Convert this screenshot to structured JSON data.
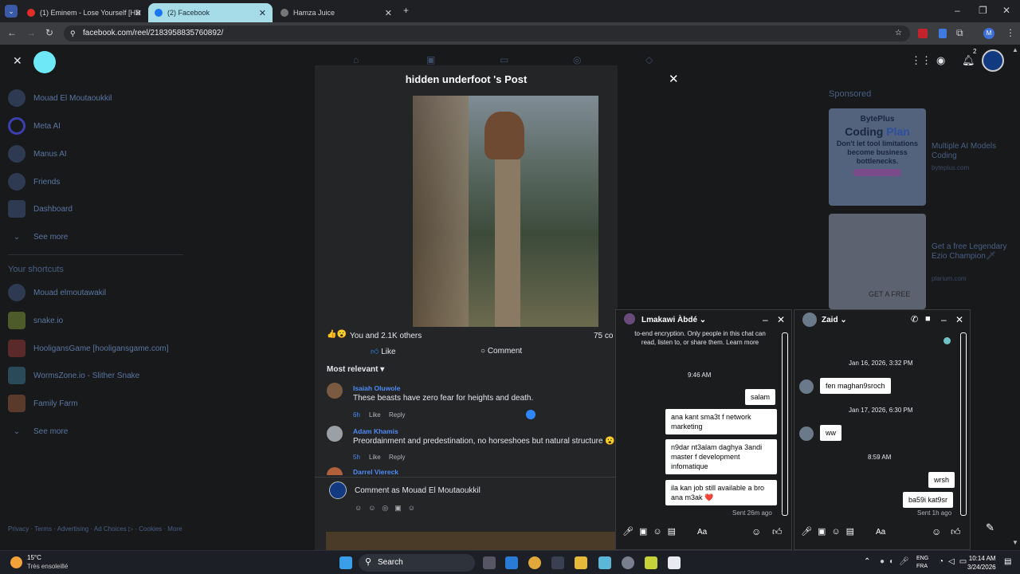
{
  "browser": {
    "tabs": [
      {
        "label": "(1) Eminem - Lose Yourself [HD",
        "active": false
      },
      {
        "label": "(2) Facebook",
        "active": true
      },
      {
        "label": "Hamza Juice",
        "active": false
      }
    ],
    "url": "facebook.com/reel/2183958835760892/"
  },
  "sidebar": {
    "items": [
      {
        "label": "Mouad El Moutaoukkil"
      },
      {
        "label": "Meta AI"
      },
      {
        "label": "Manus AI"
      },
      {
        "label": "Friends"
      },
      {
        "label": "Dashboard"
      },
      {
        "label": "See more"
      }
    ],
    "shortcuts_title": "Your shortcuts",
    "shortcuts": [
      {
        "label": "Mouad elmoutawakil"
      },
      {
        "label": "snake.io"
      },
      {
        "label": "HooligansGame [hooligansgame.com]"
      },
      {
        "label": "WormsZone.io - Slither Snake"
      },
      {
        "label": "Family Farm"
      },
      {
        "label": "See more"
      }
    ],
    "footer": "Privacy · Terms · Advertising · Ad Choices ▷ · Cookies · More"
  },
  "header": {
    "notification_count": "2"
  },
  "sponsored": {
    "title": "Sponsored",
    "ads": [
      {
        "brand": "BytePlus",
        "banner_line1": "Coding ",
        "banner_line1_accent": "Plan",
        "banner_text": "Don't let tool limitations become business bottlenecks.",
        "title": "Multiple AI Models Coding",
        "domain": "byteplus.com"
      },
      {
        "title": "Get a free Legendary Ezio Champion🗡",
        "domain": "plarium.com",
        "banner_text": "GET A FREE"
      }
    ]
  },
  "modal": {
    "title": "hidden underfoot 's Post",
    "reactions": "You and 2.1K others",
    "comment_count": "75 co",
    "like_label": "Like",
    "comment_label": "Comment",
    "sort_label": "Most relevant",
    "comments": [
      {
        "name": "Isaiah Oluwole",
        "text": "These beasts have zero fear for heights and death.",
        "time": "6h",
        "like": "Like",
        "reply": "Reply"
      },
      {
        "name": "Adam Khamis",
        "text": "Preordainment and predestination, no horseshoes but natural structure 😮",
        "time": "5h",
        "like": "Like",
        "reply": "Reply"
      },
      {
        "name": "Darrel Viereck"
      }
    ],
    "comment_placeholder": "Comment as Mouad El Moutaoukkil"
  },
  "chat1": {
    "name": "Lmakawi Àbdé",
    "encryption": "to-end encryption. Only people in this chat can read, listen to, or share them. Learn more",
    "time": "9:46 AM",
    "messages": [
      "salam",
      "ana kant sma3t f network marketing",
      "n9dar nt3alam daghya 3andi master f development infomatique",
      "ila kan job still available a bro ana m3ak ❤️"
    ],
    "status": "Sent 26m ago",
    "input": "Aa"
  },
  "chat2": {
    "name": "Zaid",
    "date1": "Jan 16, 2026, 3:32 PM",
    "msg1": "fen maghan9sroch",
    "date2": "Jan 17, 2026, 6:30 PM",
    "msg2": "ww",
    "time3": "8:59 AM",
    "msg3": "wrsh",
    "msg4": "ba59i kat9sr",
    "status": "Sent 1h ago",
    "input": "Aa"
  },
  "taskbar": {
    "temp": "15°C",
    "weather": "Très ensoleillé",
    "search": "Search",
    "lang1": "ENG",
    "lang2": "FRA",
    "time": "10:14 AM",
    "date": "3/24/2026"
  }
}
